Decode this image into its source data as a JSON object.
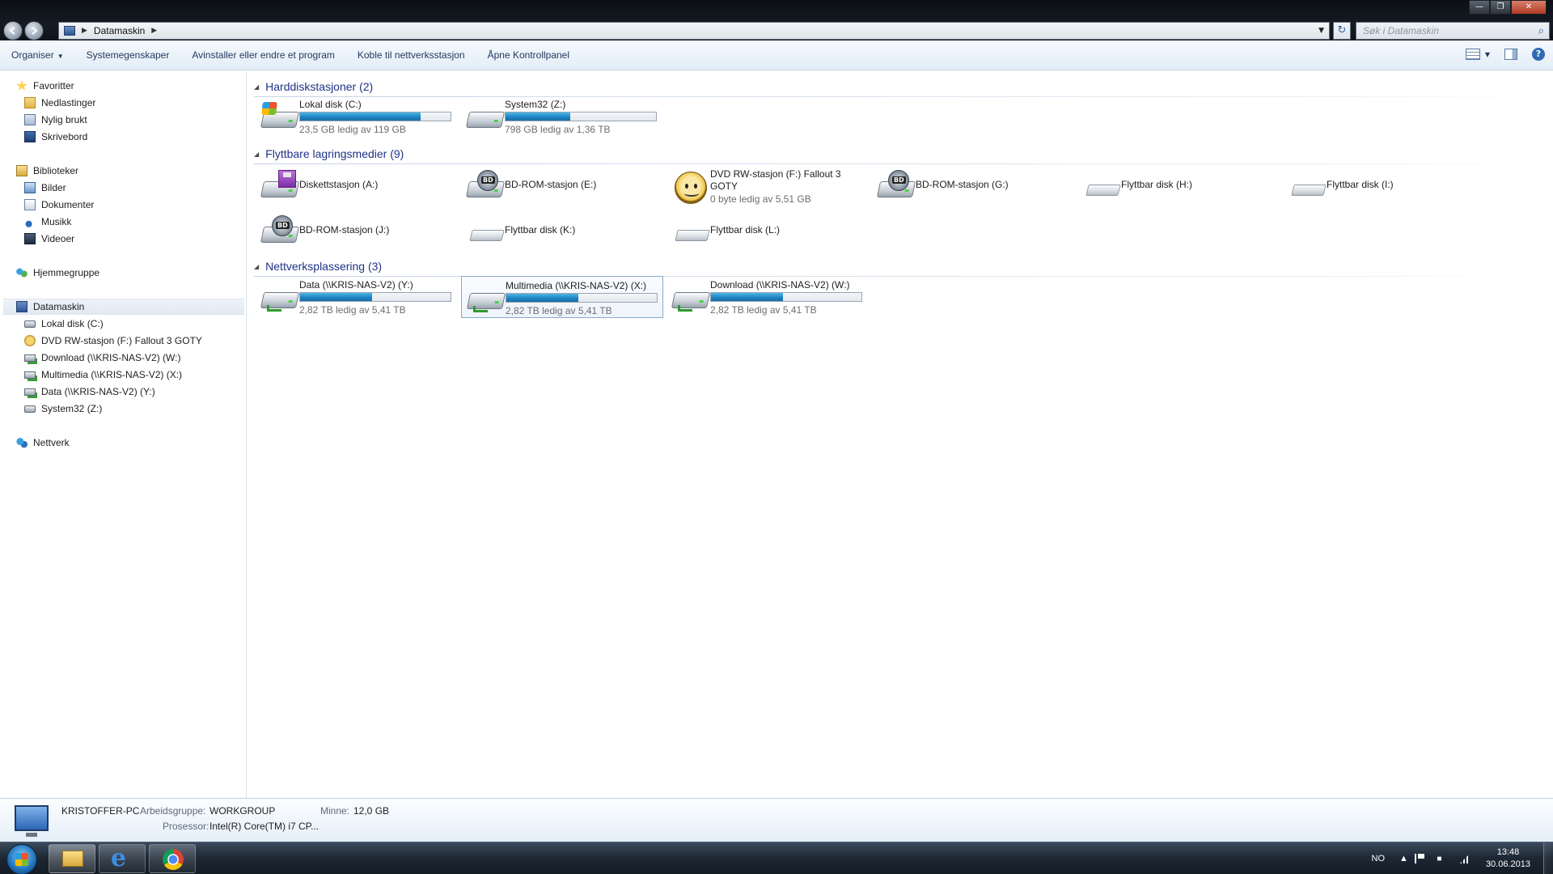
{
  "window": {
    "address_crumb": "Datamaskin",
    "search_placeholder": "Søk i Datamaskin"
  },
  "toolbar": {
    "organize": "Organiser",
    "system_properties": "Systemegenskaper",
    "uninstall": "Avinstaller eller endre et program",
    "map_network": "Koble til nettverksstasjon",
    "control_panel": "Åpne Kontrollpanel"
  },
  "nav": {
    "favorites": "Favoritter",
    "downloads": "Nedlastinger",
    "recent": "Nylig brukt",
    "desktop": "Skrivebord",
    "libraries": "Biblioteker",
    "pictures": "Bilder",
    "documents": "Dokumenter",
    "music": "Musikk",
    "videos": "Videoer",
    "homegroup": "Hjemmegruppe",
    "computer": "Datamaskin",
    "computer_items": [
      "Lokal disk (C:)",
      "DVD RW-stasjon (F:) Fallout 3 GOTY",
      "Download (\\\\KRIS-NAS-V2) (W:)",
      "Multimedia (\\\\KRIS-NAS-V2) (X:)",
      "Data (\\\\KRIS-NAS-V2) (Y:)",
      "System32 (Z:)"
    ],
    "network": "Nettverk"
  },
  "groups": {
    "hdd": {
      "title": "Harddiskstasjoner (2)"
    },
    "removable": {
      "title": "Flyttbare lagringsmedier (9)"
    },
    "network": {
      "title": "Nettverksplassering (3)"
    }
  },
  "drives": {
    "c": {
      "name": "Lokal disk (C:)",
      "info": "23,5 GB ledig av 119 GB",
      "used_fraction": 0.8
    },
    "z": {
      "name": "System32 (Z:)",
      "info": "798 GB ledig av 1,36 TB",
      "used_fraction": 0.43
    },
    "a": {
      "name": "Diskettstasjon (A:)"
    },
    "e": {
      "name": "BD-ROM-stasjon (E:)"
    },
    "f": {
      "name": "DVD RW-stasjon (F:) Fallout 3 GOTY",
      "info": "0 byte ledig av 5,51 GB"
    },
    "g": {
      "name": "BD-ROM-stasjon (G:)"
    },
    "h": {
      "name": "Flyttbar disk (H:)"
    },
    "i": {
      "name": "Flyttbar disk (I:)"
    },
    "j": {
      "name": "BD-ROM-stasjon (J:)"
    },
    "k": {
      "name": "Flyttbar disk (K:)"
    },
    "l": {
      "name": "Flyttbar disk (L:)"
    },
    "y": {
      "name": "Data (\\\\KRIS-NAS-V2) (Y:)",
      "info": "2,82 TB ledig av 5,41 TB",
      "used_fraction": 0.48
    },
    "x": {
      "name": "Multimedia (\\\\KRIS-NAS-V2) (X:)",
      "info": "2,82 TB ledig av 5,41 TB",
      "used_fraction": 0.48
    },
    "w": {
      "name": "Download (\\\\KRIS-NAS-V2) (W:)",
      "info": "2,82 TB ledig av 5,41 TB",
      "used_fraction": 0.48
    }
  },
  "details": {
    "pc_name": "KRISTOFFER-PC",
    "workgroup_label": "Arbeidsgruppe:",
    "workgroup_value": "WORKGROUP",
    "memory_label": "Minne:",
    "memory_value": "12,0 GB",
    "processor_label": "Prosessor:",
    "processor_value": "Intel(R) Core(TM) i7 CP..."
  },
  "taskbar": {
    "language": "NO",
    "time": "13:48",
    "date": "30.06.2013"
  },
  "colors": {
    "group_title": "#1e3287",
    "bar_fill": "#1e84c4",
    "taskbar": "#1d2733"
  }
}
